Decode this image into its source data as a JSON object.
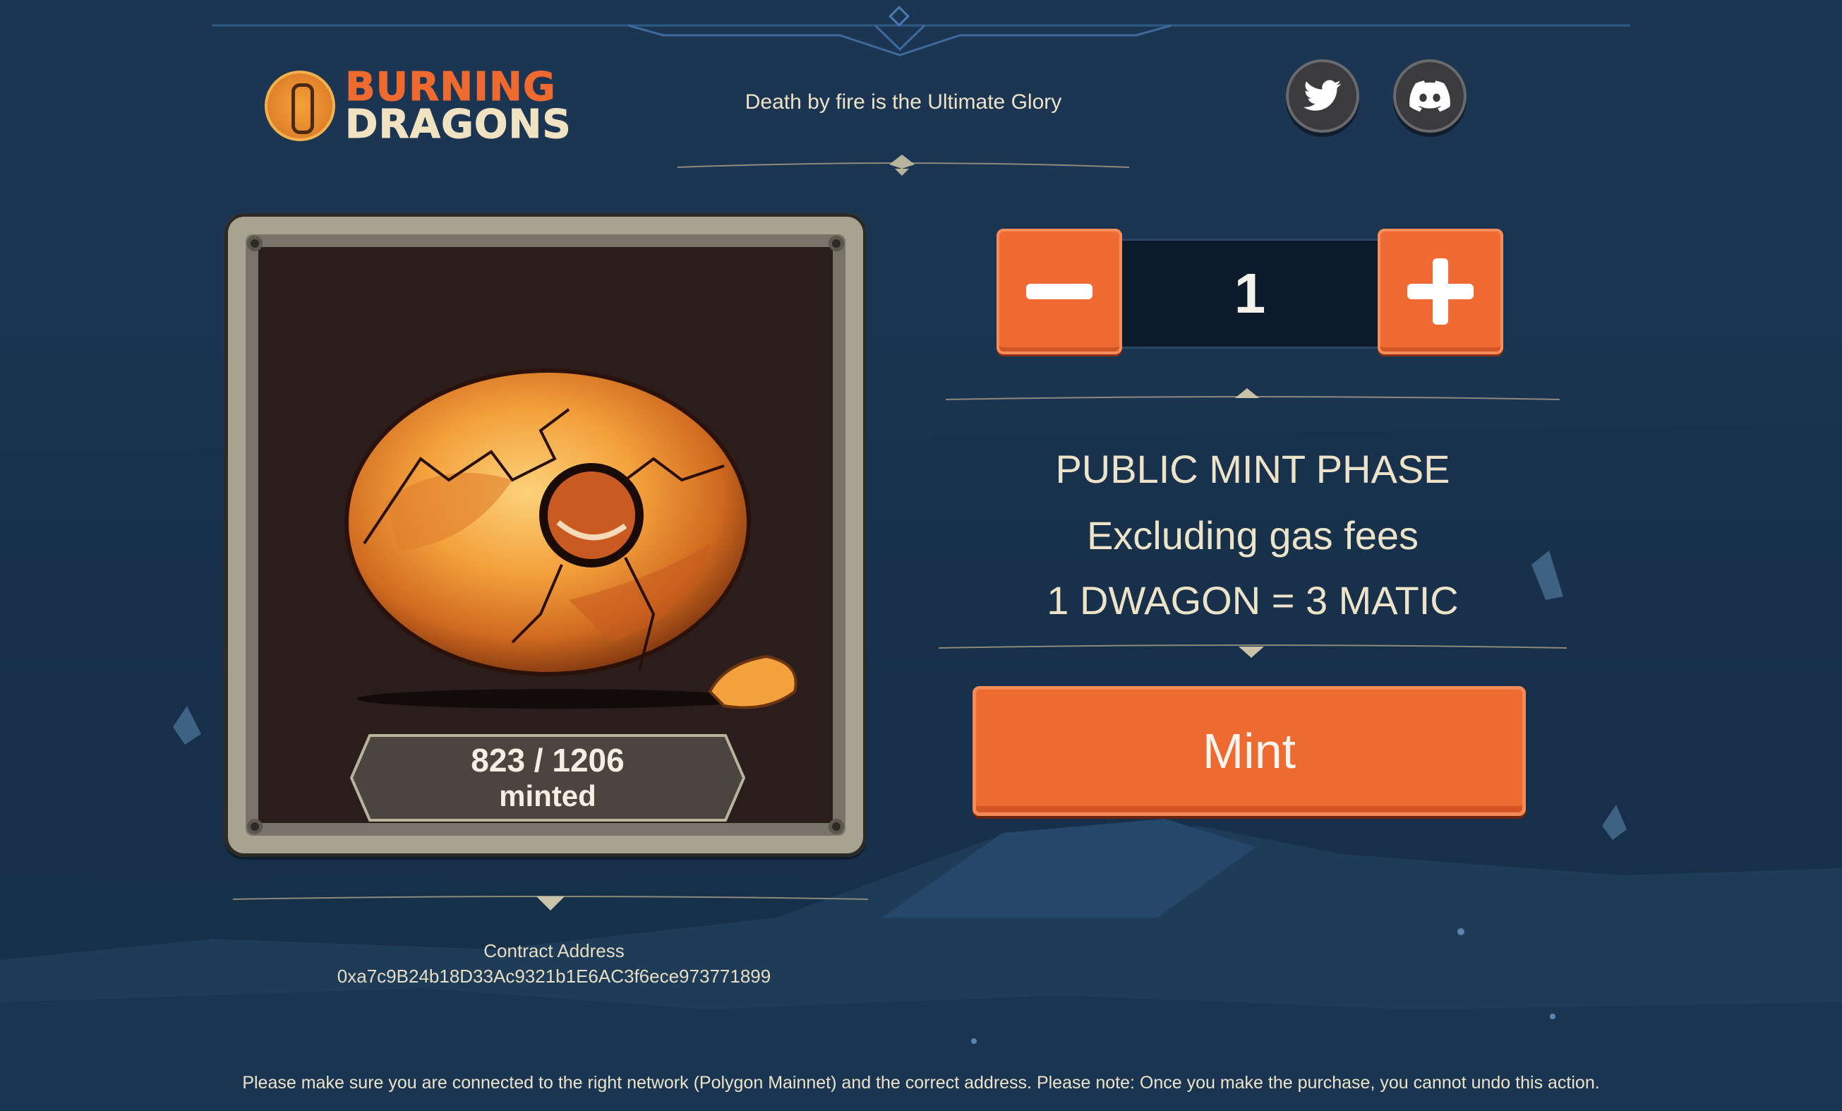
{
  "header": {
    "logo_line1": "BURNING",
    "logo_line2": "DRAGONS",
    "tagline": "Death by fire is the Ultimate Glory",
    "social": [
      {
        "name": "twitter",
        "icon": "twitter-icon"
      },
      {
        "name": "discord",
        "icon": "discord-icon"
      }
    ]
  },
  "card": {
    "image": "cracked-dragon-egg",
    "minted_count": "823 / 1206",
    "minted_label": "minted",
    "minted": 823,
    "supply": 1206
  },
  "contract": {
    "label": "Contract Address",
    "address": "0xa7c9B24b18D33Ac9321b1E6AC3f6ece973771899"
  },
  "stepper": {
    "value": "1",
    "minus_icon": "minus-icon",
    "plus_icon": "plus-icon"
  },
  "mint_info": {
    "phase": "PUBLIC MINT PHASE",
    "gas_note": "Excluding gas fees",
    "price": "1 DWAGON = 3 MATIC"
  },
  "mint_button": {
    "label": "Mint"
  },
  "footer": {
    "note": "Please make sure you are connected to the right network (Polygon Mainnet) and the correct address. Please note: Once you make the purchase, you cannot undo this action."
  },
  "colors": {
    "background": "#1a3450",
    "accent_orange": "#ed6a31",
    "text_cream": "#ece3c9",
    "card_interior": "#2b1d1b"
  }
}
